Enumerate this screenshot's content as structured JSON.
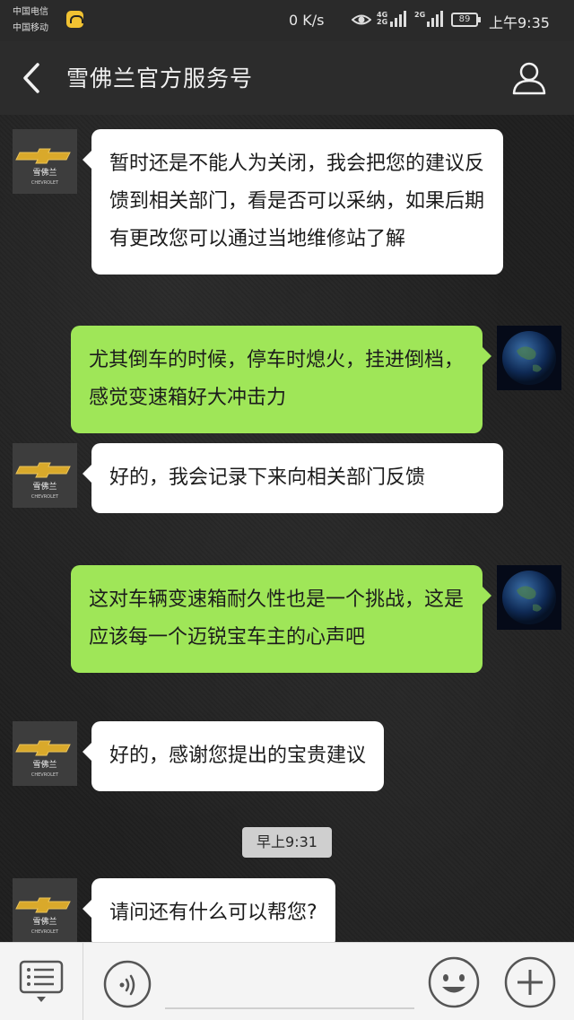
{
  "status_bar": {
    "carrier1": "中国电信",
    "carrier2": "中国移动",
    "net_speed": "0 K/s",
    "signal1_label": "4G\n2G",
    "signal2_label": "2G",
    "battery": "89",
    "time": "上午9:35"
  },
  "header": {
    "title": "雪佛兰官方服务号",
    "back_icon": "chevron-left-icon",
    "profile_icon": "person-icon"
  },
  "brand_avatar": {
    "name": "雪佛兰",
    "sub": "CHEVROLET"
  },
  "messages": [
    {
      "from": "brand",
      "text": "暂时还是不能人为关闭，我会把您的建议反馈到相关部门，看是否可以采纳，如果后期有更改您可以通过当地维修站了解"
    },
    {
      "from": "user",
      "text": "尤其倒车的时候，停车时熄火，挂进倒档，感觉变速箱好大冲击力"
    },
    {
      "from": "brand",
      "text": "好的，我会记录下来向相关部门反馈"
    },
    {
      "from": "user",
      "text": "这对车辆变速箱耐久性也是一个挑战，这是应该每一个迈锐宝车主的心声吧"
    },
    {
      "from": "brand",
      "text": "好的，感谢您提出的宝贵建议"
    },
    {
      "from": "brand",
      "text": "请问还有什么可以帮您?"
    }
  ],
  "time_divider": "早上9:31",
  "input_bar": {
    "menu_icon": "menu-list-icon",
    "voice_icon": "voice-icon",
    "emoji_icon": "smiley-icon",
    "plus_icon": "plus-icon"
  }
}
